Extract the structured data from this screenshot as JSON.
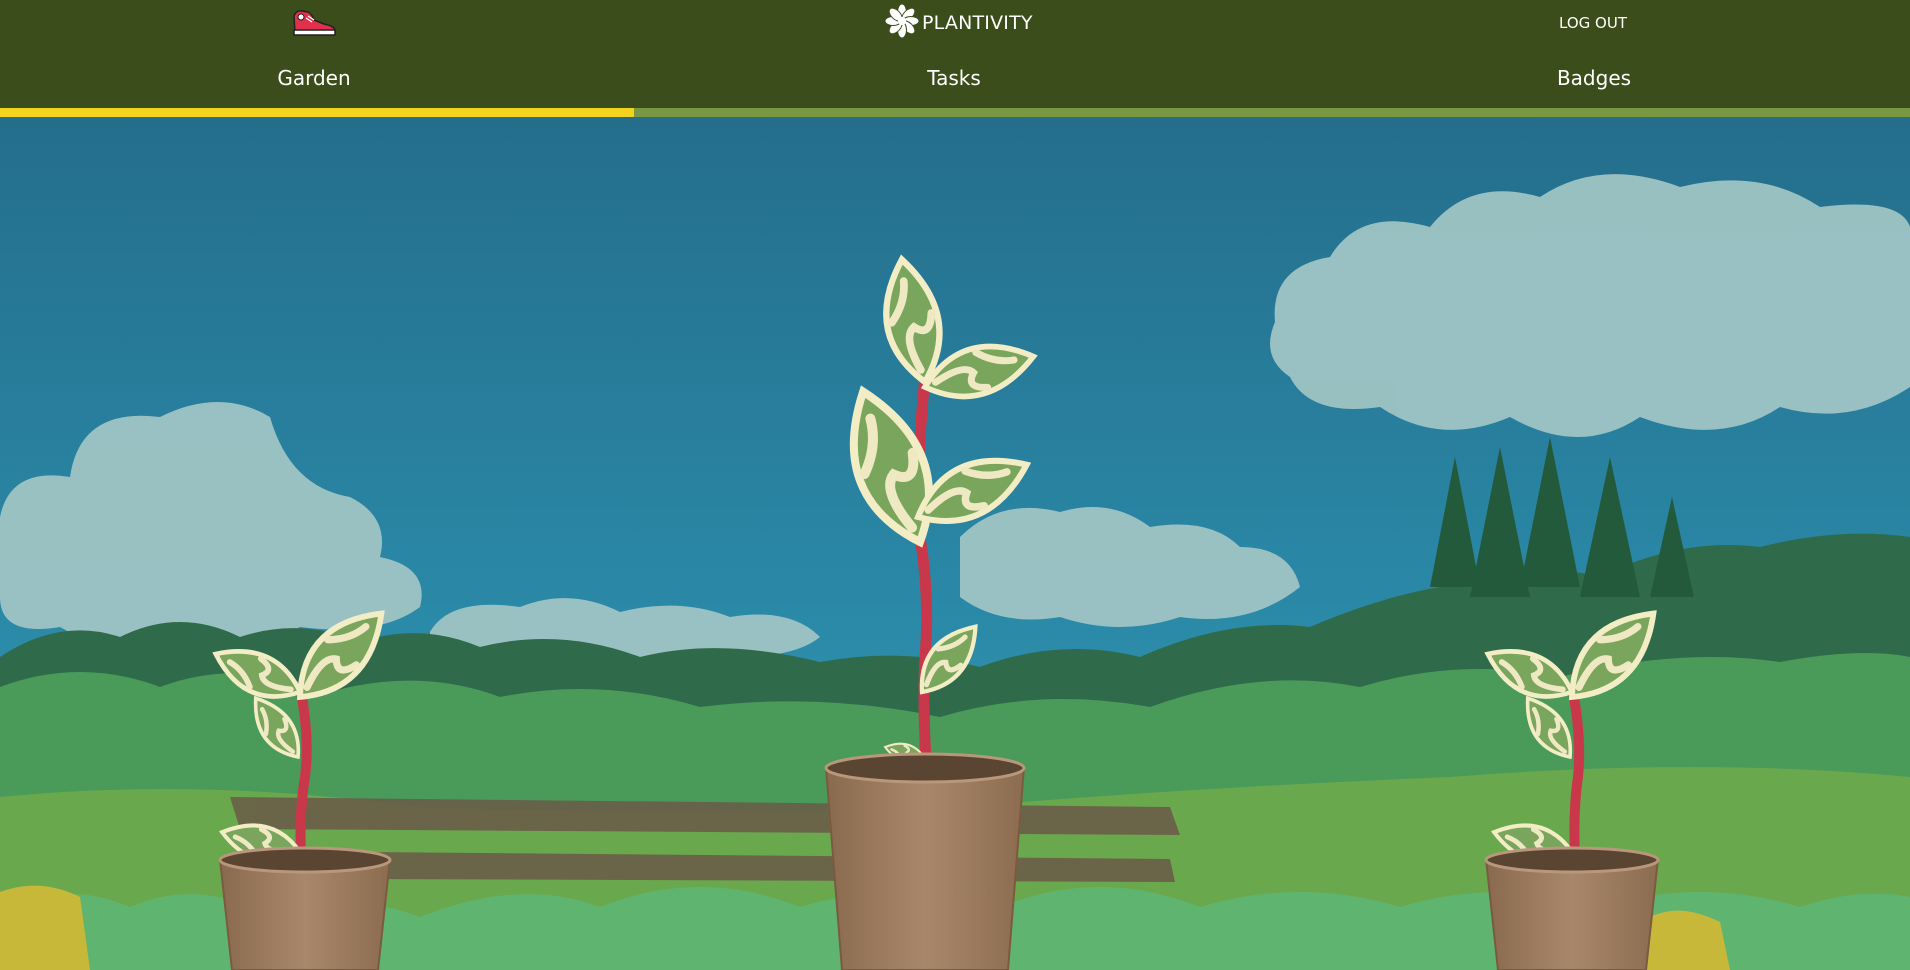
{
  "header": {
    "brand_name": "PLANTIVITY",
    "logo_icon": "flower-logo-icon",
    "avatar_icon": "red-sneaker-icon",
    "logout_label": "LOG OUT"
  },
  "nav": {
    "tabs": [
      {
        "label": "Garden",
        "active": true
      },
      {
        "label": "Tasks",
        "active": false
      },
      {
        "label": "Badges",
        "active": false
      }
    ]
  },
  "colors": {
    "header_bg": "#3b4d1a",
    "active_tab_indicator": "#f2d41f",
    "tab_track": "#7a9744",
    "sky": "#2a7f9c",
    "pot": "#a07f5f",
    "stem": "#c9384a",
    "leaf": "#78a35a"
  },
  "garden": {
    "scene": "sky-clouds-trees-landscape",
    "plants": [
      {
        "name": "plant-left",
        "icon": "potted-plant-icon"
      },
      {
        "name": "plant-center",
        "icon": "potted-plant-icon"
      },
      {
        "name": "plant-right",
        "icon": "potted-plant-icon"
      }
    ]
  }
}
